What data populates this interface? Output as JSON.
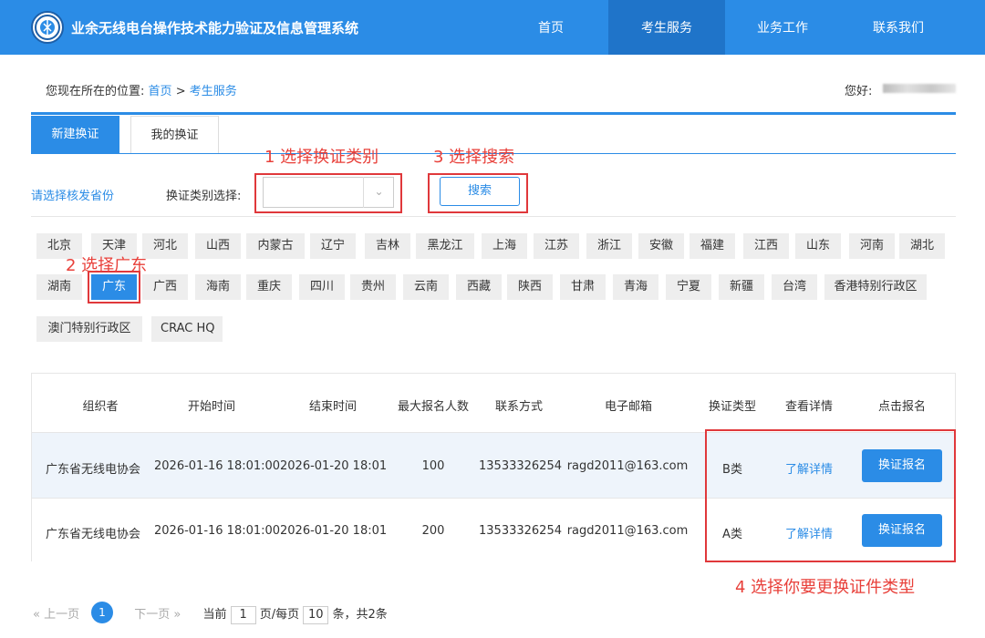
{
  "header": {
    "title": "业余无线电台操作技术能力验证及信息管理系统",
    "nav": [
      {
        "label": "首页"
      },
      {
        "label": "考生服务"
      },
      {
        "label": "业务工作"
      },
      {
        "label": "联系我们"
      }
    ],
    "active_nav": "考生服务"
  },
  "breadcrumb": {
    "prefix": "您现在所在的位置:",
    "home": "首页",
    "separator": ">",
    "current": "考生服务"
  },
  "greeting": "您好:",
  "tabs": [
    {
      "label": "新建换证"
    },
    {
      "label": "我的换证"
    }
  ],
  "filter": {
    "province_hint": "请选择核发省份",
    "type_label": "换证类别选择:",
    "type_value": "",
    "search_label": "搜索"
  },
  "annotations": {
    "step1": "1 选择换证类别",
    "step2": "2 选择广东",
    "step3": "3 选择搜索",
    "step4": "4 选择你要更换证件类型"
  },
  "provinces": [
    "北京",
    "天津",
    "河北",
    "山西",
    "内蒙古",
    "辽宁",
    "吉林",
    "黑龙江",
    "上海",
    "江苏",
    "浙江",
    "安徽",
    "福建",
    "江西",
    "山东",
    "河南",
    "湖北",
    "湖南",
    "广东",
    "广西",
    "海南",
    "重庆",
    "四川",
    "贵州",
    "云南",
    "西藏",
    "陕西",
    "甘肃",
    "青海",
    "宁夏",
    "新疆",
    "台湾",
    "香港特别行政区",
    "澳门特别行政区",
    "CRAC HQ"
  ],
  "selected_province": "广东",
  "table": {
    "headers": [
      "组织者",
      "开始时间",
      "结束时间",
      "最大报名人数",
      "联系方式",
      "电子邮箱",
      "换证类型",
      "查看详情",
      "点击报名"
    ],
    "rows": [
      {
        "organizer": "广东省无线电协会",
        "start": "2026-01-16 18:01:00",
        "end": "2026-01-20 18:01",
        "max": "100",
        "phone": "13533326254",
        "email": "ragd2011@163.com",
        "type": "B类",
        "detail": "了解详情",
        "enroll": "换证报名"
      },
      {
        "organizer": "广东省无线电协会",
        "start": "2026-01-16 18:01:00",
        "end": "2026-01-20 18:01",
        "max": "200",
        "phone": "13533326254",
        "email": "ragd2011@163.com",
        "type": "A类",
        "detail": "了解详情",
        "enroll": "换证报名"
      }
    ]
  },
  "pager": {
    "prev": "« 上一页",
    "page": "1",
    "next": "下一页 »",
    "current_label": "当前",
    "current_page": "1",
    "per_page_label": "页/每页",
    "per_page": "10",
    "total_label": "条，共2条"
  },
  "colors": {
    "primary": "#2b8ce6",
    "nav_active": "#1f74c9",
    "annotation": "#e8403a"
  }
}
